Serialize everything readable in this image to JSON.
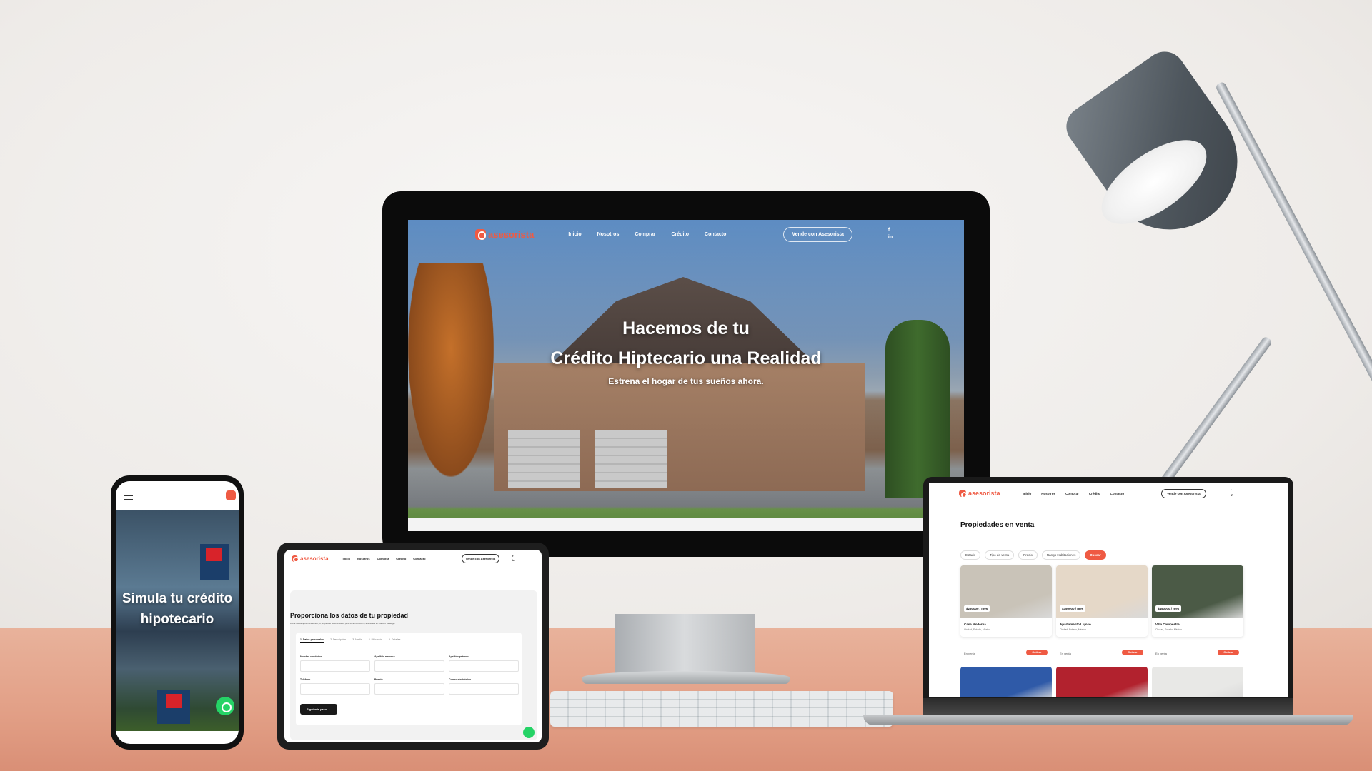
{
  "brand": {
    "name": "asesorista",
    "accent": "#ef5a43",
    "whatsapp": "#25d366"
  },
  "nav": {
    "items": [
      "Inicio",
      "Nosotros",
      "Comprar",
      "Crédito",
      "Contacto"
    ],
    "cta": "Vende con Asesorista",
    "social": [
      "f",
      "in"
    ]
  },
  "desktop": {
    "hero_line1": "Hacemos de tu",
    "hero_line2": "Crédito Hiptecario una Realidad",
    "hero_sub": "Estrena el hogar de tus sueños ahora."
  },
  "phone": {
    "title": "Simula tu crédito hipotecario",
    "whatsapp_icon": "whatsapp-icon"
  },
  "tablet": {
    "title": "Proporciona los datos de tu propiedad",
    "description": "Llena los campos necesarios, tu propiedad será revisada para su aprobación y aparecerá en nuestro catálogo.",
    "steps": [
      "1. Datos personales",
      "2. Descripción",
      "3. Media",
      "4. Ubicación",
      "5. Detalles"
    ],
    "fields": [
      "Nombre vendedor",
      "Apellido materno",
      "Apellido paterno",
      "Teléfono",
      "Puesto",
      "Correo electrónico"
    ],
    "next_button": "Siguiente paso →"
  },
  "laptop": {
    "title": "Propiedades en venta",
    "filters": [
      "Estado",
      "Tipo de venta",
      "Precio",
      "Rango Habitaciones"
    ],
    "filter_button": "Buscar",
    "cards": [
      {
        "price": "$250000 / mes",
        "name": "Casa Moderna",
        "location": "Ciudad, Estado, México",
        "status": "En venta",
        "action": "Cotizar",
        "color": "#c9c3b8"
      },
      {
        "price": "$350000 / mes",
        "name": "Apartamento Lujoso",
        "location": "Ciudad, Estado, México",
        "status": "En venta",
        "action": "Cotizar",
        "color": "#e5d8c8"
      },
      {
        "price": "$450000 / mes",
        "name": "Villa Campestre",
        "location": "Ciudad, Estado, México",
        "status": "En venta",
        "action": "Cotizar",
        "color": "#4b5a46"
      }
    ],
    "row2_colors": [
      "#2f5aa8",
      "#b2222e",
      "#e8e8e6"
    ]
  }
}
